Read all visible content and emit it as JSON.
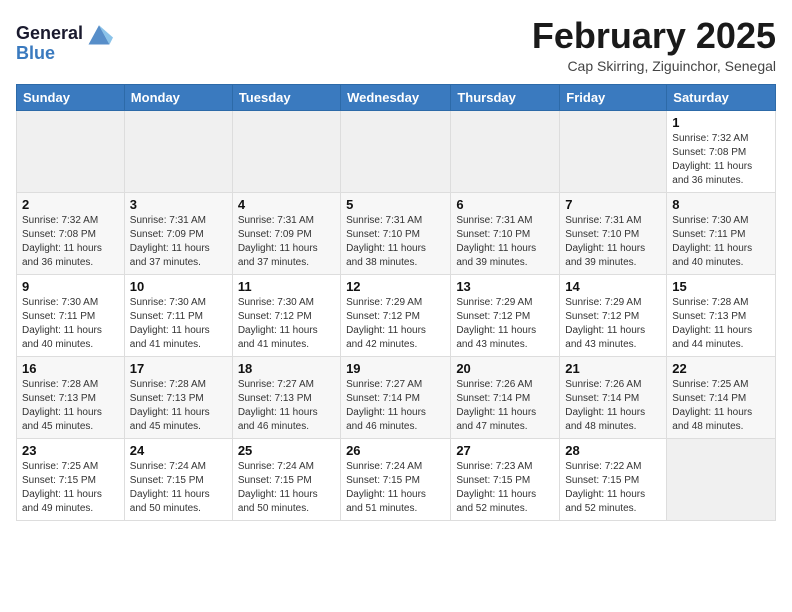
{
  "header": {
    "logo_line1": "General",
    "logo_line2": "Blue",
    "month_year": "February 2025",
    "location": "Cap Skirring, Ziguinchor, Senegal"
  },
  "days_of_week": [
    "Sunday",
    "Monday",
    "Tuesday",
    "Wednesday",
    "Thursday",
    "Friday",
    "Saturday"
  ],
  "weeks": [
    [
      {
        "day": "",
        "info": ""
      },
      {
        "day": "",
        "info": ""
      },
      {
        "day": "",
        "info": ""
      },
      {
        "day": "",
        "info": ""
      },
      {
        "day": "",
        "info": ""
      },
      {
        "day": "",
        "info": ""
      },
      {
        "day": "1",
        "info": "Sunrise: 7:32 AM\nSunset: 7:08 PM\nDaylight: 11 hours and 36 minutes."
      }
    ],
    [
      {
        "day": "2",
        "info": "Sunrise: 7:32 AM\nSunset: 7:08 PM\nDaylight: 11 hours and 36 minutes."
      },
      {
        "day": "3",
        "info": "Sunrise: 7:31 AM\nSunset: 7:09 PM\nDaylight: 11 hours and 37 minutes."
      },
      {
        "day": "4",
        "info": "Sunrise: 7:31 AM\nSunset: 7:09 PM\nDaylight: 11 hours and 37 minutes."
      },
      {
        "day": "5",
        "info": "Sunrise: 7:31 AM\nSunset: 7:10 PM\nDaylight: 11 hours and 38 minutes."
      },
      {
        "day": "6",
        "info": "Sunrise: 7:31 AM\nSunset: 7:10 PM\nDaylight: 11 hours and 39 minutes."
      },
      {
        "day": "7",
        "info": "Sunrise: 7:31 AM\nSunset: 7:10 PM\nDaylight: 11 hours and 39 minutes."
      },
      {
        "day": "8",
        "info": "Sunrise: 7:30 AM\nSunset: 7:11 PM\nDaylight: 11 hours and 40 minutes."
      }
    ],
    [
      {
        "day": "9",
        "info": "Sunrise: 7:30 AM\nSunset: 7:11 PM\nDaylight: 11 hours and 40 minutes."
      },
      {
        "day": "10",
        "info": "Sunrise: 7:30 AM\nSunset: 7:11 PM\nDaylight: 11 hours and 41 minutes."
      },
      {
        "day": "11",
        "info": "Sunrise: 7:30 AM\nSunset: 7:12 PM\nDaylight: 11 hours and 41 minutes."
      },
      {
        "day": "12",
        "info": "Sunrise: 7:29 AM\nSunset: 7:12 PM\nDaylight: 11 hours and 42 minutes."
      },
      {
        "day": "13",
        "info": "Sunrise: 7:29 AM\nSunset: 7:12 PM\nDaylight: 11 hours and 43 minutes."
      },
      {
        "day": "14",
        "info": "Sunrise: 7:29 AM\nSunset: 7:12 PM\nDaylight: 11 hours and 43 minutes."
      },
      {
        "day": "15",
        "info": "Sunrise: 7:28 AM\nSunset: 7:13 PM\nDaylight: 11 hours and 44 minutes."
      }
    ],
    [
      {
        "day": "16",
        "info": "Sunrise: 7:28 AM\nSunset: 7:13 PM\nDaylight: 11 hours and 45 minutes."
      },
      {
        "day": "17",
        "info": "Sunrise: 7:28 AM\nSunset: 7:13 PM\nDaylight: 11 hours and 45 minutes."
      },
      {
        "day": "18",
        "info": "Sunrise: 7:27 AM\nSunset: 7:13 PM\nDaylight: 11 hours and 46 minutes."
      },
      {
        "day": "19",
        "info": "Sunrise: 7:27 AM\nSunset: 7:14 PM\nDaylight: 11 hours and 46 minutes."
      },
      {
        "day": "20",
        "info": "Sunrise: 7:26 AM\nSunset: 7:14 PM\nDaylight: 11 hours and 47 minutes."
      },
      {
        "day": "21",
        "info": "Sunrise: 7:26 AM\nSunset: 7:14 PM\nDaylight: 11 hours and 48 minutes."
      },
      {
        "day": "22",
        "info": "Sunrise: 7:25 AM\nSunset: 7:14 PM\nDaylight: 11 hours and 48 minutes."
      }
    ],
    [
      {
        "day": "23",
        "info": "Sunrise: 7:25 AM\nSunset: 7:15 PM\nDaylight: 11 hours and 49 minutes."
      },
      {
        "day": "24",
        "info": "Sunrise: 7:24 AM\nSunset: 7:15 PM\nDaylight: 11 hours and 50 minutes."
      },
      {
        "day": "25",
        "info": "Sunrise: 7:24 AM\nSunset: 7:15 PM\nDaylight: 11 hours and 50 minutes."
      },
      {
        "day": "26",
        "info": "Sunrise: 7:24 AM\nSunset: 7:15 PM\nDaylight: 11 hours and 51 minutes."
      },
      {
        "day": "27",
        "info": "Sunrise: 7:23 AM\nSunset: 7:15 PM\nDaylight: 11 hours and 52 minutes."
      },
      {
        "day": "28",
        "info": "Sunrise: 7:22 AM\nSunset: 7:15 PM\nDaylight: 11 hours and 52 minutes."
      },
      {
        "day": "",
        "info": ""
      }
    ]
  ]
}
